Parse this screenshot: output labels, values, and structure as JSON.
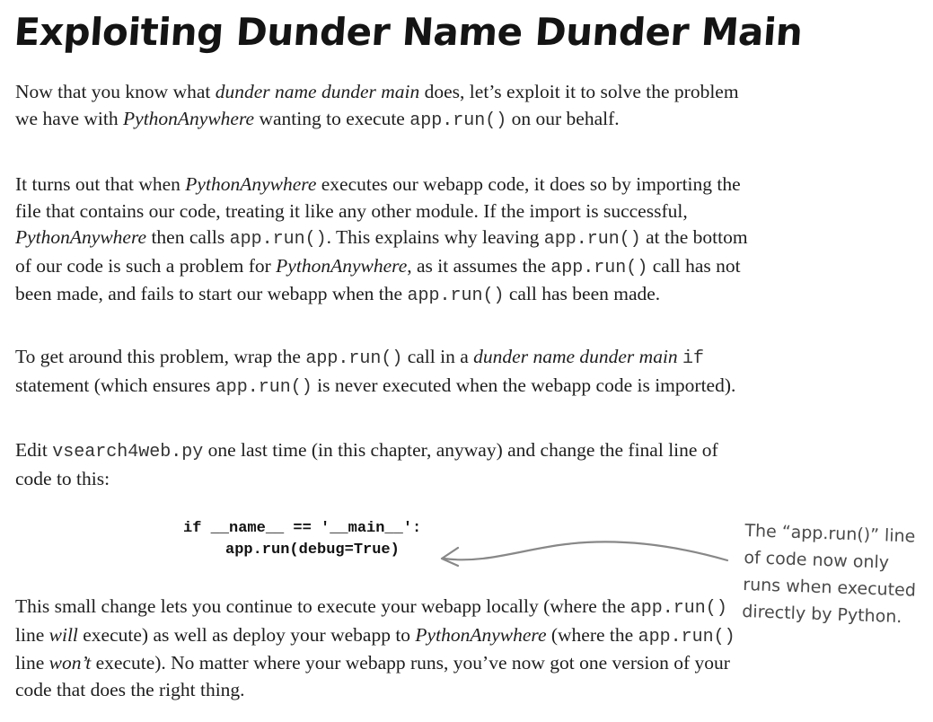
{
  "title": "Exploiting Dunder Name Dunder Main",
  "paragraphs": {
    "p1": [
      {
        "t": "Now that you know what "
      },
      {
        "t": "dunder name dunder main",
        "s": "em"
      },
      {
        "t": " does, let’s exploit it to solve the problem we have with "
      },
      {
        "t": "PythonAnywhere",
        "s": "em"
      },
      {
        "t": " wanting to execute "
      },
      {
        "t": "app.run()",
        "s": "code"
      },
      {
        "t": " on our behalf."
      }
    ],
    "p2": [
      {
        "t": "It turns out that when "
      },
      {
        "t": "PythonAnywhere",
        "s": "em"
      },
      {
        "t": " executes our webapp code, it does so by importing the file that contains our code, treating it like any other module. If the import is successful, "
      },
      {
        "t": "PythonAnywhere",
        "s": "em"
      },
      {
        "t": " then calls "
      },
      {
        "t": "app.run()",
        "s": "code"
      },
      {
        "t": ". This explains why leaving "
      },
      {
        "t": "app.run()",
        "s": "code"
      },
      {
        "t": " at the bottom of our code is such a problem for "
      },
      {
        "t": "PythonAnywhere",
        "s": "em"
      },
      {
        "t": ", as it assumes the "
      },
      {
        "t": "app.run()",
        "s": "code"
      },
      {
        "t": " call has not been made, and fails to start our webapp when the "
      },
      {
        "t": "app.run()",
        "s": "code"
      },
      {
        "t": " call has been made."
      }
    ],
    "p3": [
      {
        "t": "To get around this problem, wrap the "
      },
      {
        "t": "app.run()",
        "s": "code"
      },
      {
        "t": " call in a "
      },
      {
        "t": "dunder name dunder main",
        "s": "em"
      },
      {
        "t": " "
      },
      {
        "t": "if",
        "s": "code"
      },
      {
        "t": " statement (which ensures "
      },
      {
        "t": "app.run()",
        "s": "code"
      },
      {
        "t": " is never executed when the webapp code is imported)."
      }
    ],
    "p4": [
      {
        "t": "Edit "
      },
      {
        "t": "vsearch4web.py",
        "s": "code"
      },
      {
        "t": " one last time (in this chapter, anyway) and change the final line of code to this:"
      }
    ],
    "p5": [
      {
        "t": "This small change lets you continue to execute your webapp locally (where the "
      },
      {
        "t": "app.run()",
        "s": "code"
      },
      {
        "t": " line "
      },
      {
        "t": "will",
        "s": "em"
      },
      {
        "t": " execute) as well as deploy your webapp to "
      },
      {
        "t": "PythonAnywhere",
        "s": "em"
      },
      {
        "t": " (where the "
      },
      {
        "t": "app.run()",
        "s": "code"
      },
      {
        "t": " line "
      },
      {
        "t": "won’t",
        "s": "em"
      },
      {
        "t": " execute). No matter where your webapp runs, you’ve now got one version of your code that does the right thing."
      }
    ]
  },
  "code": {
    "line1": "if __name__ == '__main__':",
    "line2": "app.run(debug=True)"
  },
  "annotation": {
    "lines": [
      "The “app.run()” line",
      "of code now only",
      "runs when executed",
      "directly by Python."
    ]
  },
  "colors": {
    "text": "#1e1e1e",
    "annotation": "#4a4a4a",
    "arrow": "#888888"
  }
}
